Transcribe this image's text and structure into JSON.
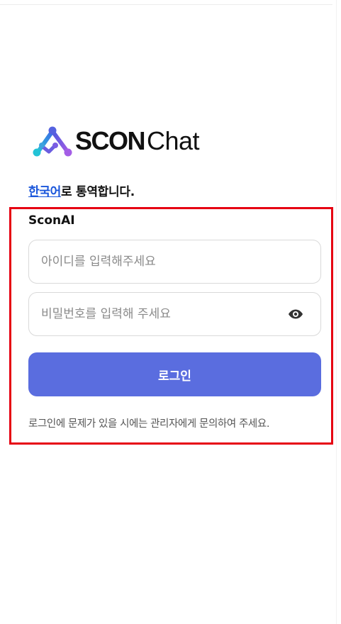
{
  "brand": {
    "logo_bold": "SCON",
    "logo_light": "Chat",
    "logo_icon": "network-triangle-logo-icon"
  },
  "translate": {
    "language_link": "한국어",
    "suffix": "로 통역합니다."
  },
  "login": {
    "organization": "SconAI",
    "id_placeholder": "아이디를 입력해주세요",
    "password_placeholder": "비밀번호를 입력해 주세요",
    "password_toggle_icon": "eye-icon",
    "submit_label": "로그인",
    "help_text": "로그인에 문제가 있을 시에는 관리자에게 문의하여 주세요."
  },
  "colors": {
    "primary_button": "#5a6ddf",
    "link": "#1a56db",
    "highlight_border": "#e60012"
  }
}
